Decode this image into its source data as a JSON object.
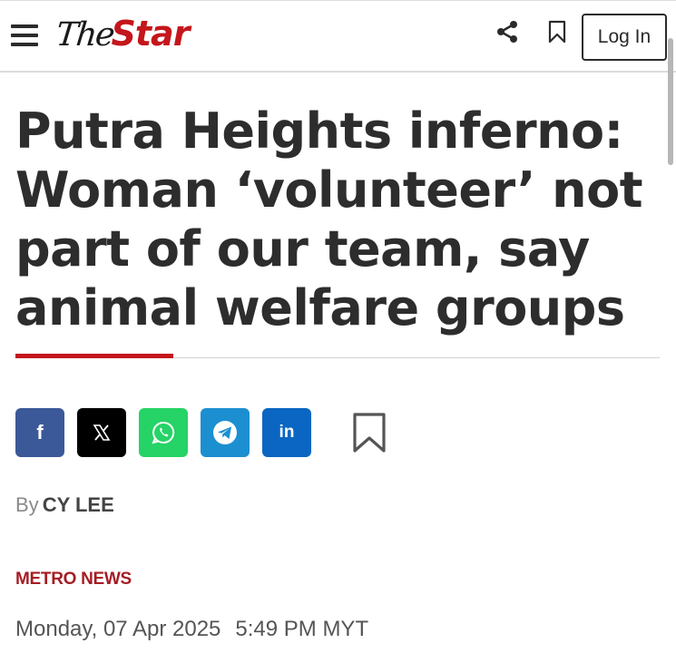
{
  "header": {
    "logo_the": "The",
    "logo_star": "Star",
    "login_label": "Log In",
    "icons": [
      "menu-icon",
      "share-icon",
      "bookmark-icon"
    ]
  },
  "article": {
    "headline": "Putra Heights inferno: Woman ‘volunteer’ not part of our team, say animal welfare groups",
    "byline_prefix": "By",
    "author": "CY LEE",
    "category": "METRO NEWS",
    "date": "Monday, 07 Apr 2025",
    "time": "5:49 PM MYT"
  },
  "share": {
    "buttons": [
      {
        "network": "facebook",
        "glyph": "f",
        "color": "#3b5998"
      },
      {
        "network": "x",
        "glyph": "𝕏",
        "color": "#000000"
      },
      {
        "network": "whatsapp",
        "glyph": "",
        "color": "#25d366"
      },
      {
        "network": "telegram",
        "glyph": "",
        "color": "#1c8fd1"
      },
      {
        "network": "linkedin",
        "glyph": "in",
        "color": "#0a66c2"
      }
    ]
  },
  "colors": {
    "brand_red": "#c4161c",
    "category_red": "#a51d24",
    "text_dark": "#2d2d2d"
  }
}
